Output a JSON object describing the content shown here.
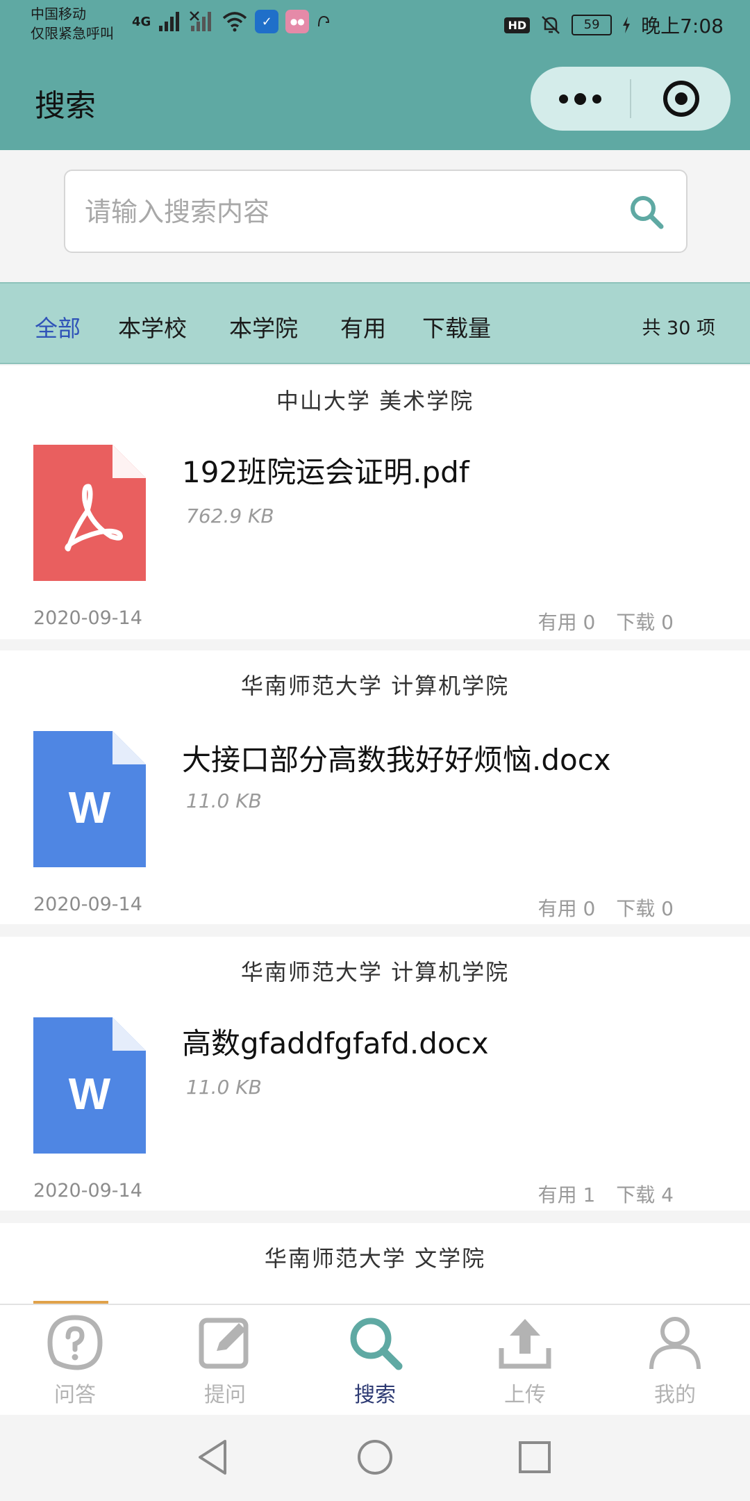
{
  "status_bar": {
    "carrier_line1": "中国移动",
    "carrier_line2": "仅限紧急呼叫",
    "network": "4G",
    "hd": "HD",
    "battery": "59",
    "time": "晚上7:08"
  },
  "header": {
    "title": "搜索",
    "more_icon": "more-dots-icon",
    "close_icon": "target-close-icon"
  },
  "search": {
    "placeholder": "请输入搜索内容",
    "value": ""
  },
  "filters": {
    "tabs": [
      "全部",
      "本学校",
      "本学院",
      "有用",
      "下载量"
    ],
    "active": "全部",
    "count_text": "共 30 项"
  },
  "results": [
    {
      "school": "中山大学   美术学院",
      "file_type": "pdf",
      "file_name": "192班院运会证明.pdf",
      "size": "762.9 KB",
      "date": "2020-09-14",
      "useful": "有用 0",
      "downloads": "下载 0"
    },
    {
      "school": "华南师范大学   计算机学院",
      "file_type": "docx",
      "file_name": "大接口部分高数我好好烦恼.docx",
      "size": "11.0 KB",
      "date": "2020-09-14",
      "useful": "有用 0",
      "downloads": "下载 0"
    },
    {
      "school": "华南师范大学   计算机学院",
      "file_type": "docx",
      "file_name": "高数gfaddfgfafd.docx",
      "size": "11.0 KB",
      "date": "2020-09-14",
      "useful": "有用 1",
      "downloads": "下载 4"
    },
    {
      "school": "华南师范大学   文学院"
    }
  ],
  "tab_bar": {
    "items": [
      {
        "label": "问答",
        "icon": "question-bubble-icon"
      },
      {
        "label": "提问",
        "icon": "edit-icon"
      },
      {
        "label": "搜索",
        "icon": "search-icon"
      },
      {
        "label": "上传",
        "icon": "upload-icon"
      },
      {
        "label": "我的",
        "icon": "person-icon"
      }
    ],
    "active": "搜索"
  },
  "colors": {
    "brand": "#5fa9a3",
    "filter_bg": "#a9d6cf",
    "pdf": "#e95f5f",
    "word": "#4f86e3",
    "active_tab": "#2d3a73",
    "active_filter": "#2f53b8"
  }
}
